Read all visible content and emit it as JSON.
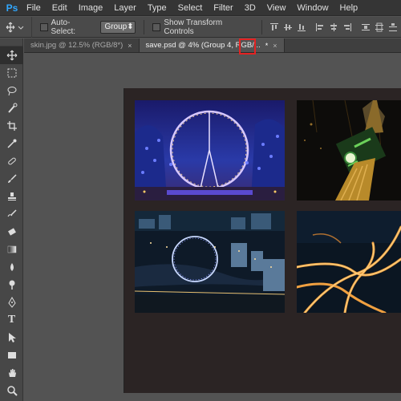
{
  "app": {
    "logo": "Ps"
  },
  "menu": [
    "File",
    "Edit",
    "Image",
    "Layer",
    "Type",
    "Select",
    "Filter",
    "3D",
    "View",
    "Window",
    "Help"
  ],
  "options": {
    "auto_select_label": "Auto-Select:",
    "auto_select_value": "Group",
    "show_transform_label": "Show Transform Controls"
  },
  "tabs": [
    {
      "label": "skin.jpg @ 12.5% (RGB/8*)",
      "close": "×"
    },
    {
      "label": "save.psd @ 4% (Group 4, RGB/...",
      "close": "*",
      "close2": "×"
    }
  ],
  "colors": {
    "accent": "#31a8ff",
    "highlight": "#e52222",
    "canvas": "#2b2424"
  },
  "icons": [
    "move-tool-icon",
    "marquee-icon",
    "lasso-icon",
    "quick-select-icon",
    "crop-icon",
    "eyedropper-icon",
    "healing-icon",
    "brush-icon",
    "stamp-icon",
    "history-brush-icon",
    "eraser-icon",
    "gradient-icon",
    "blur-icon",
    "dodge-icon",
    "pen-icon",
    "type-icon",
    "path-select-icon",
    "rectangle-icon",
    "hand-icon",
    "zoom-icon"
  ]
}
